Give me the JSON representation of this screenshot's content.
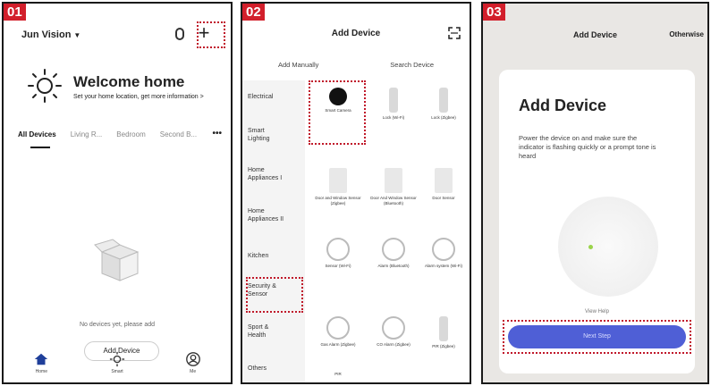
{
  "steps": [
    "01",
    "02",
    "03"
  ],
  "screen1": {
    "home_name": "Jun Vision",
    "welcome_title": "Welcome home",
    "welcome_sub": "Set your home location, get more information >",
    "tabs": [
      "All Devices",
      "Living R...",
      "Bedroom",
      "Second B..."
    ],
    "more": "•••",
    "empty_text": "No devices yet, please add",
    "add_device_button": "Add Device",
    "nav": [
      {
        "label": "Home",
        "icon": "home-icon"
      },
      {
        "label": "Smart",
        "icon": "sun-icon"
      },
      {
        "label": "Me",
        "icon": "profile-icon"
      }
    ]
  },
  "screen2": {
    "title": "Add Device",
    "subtabs": [
      "Add Manually",
      "Search Device"
    ],
    "categories": [
      "Electrical",
      "Smart Lighting",
      "Home Appliances I",
      "Home Appliances II",
      "Kitchen",
      "Security & Sensor",
      "Sport & Health",
      "Others"
    ],
    "devices": [
      {
        "label": "Smart Camera"
      },
      {
        "label": "Lock (Wi-Fi)"
      },
      {
        "label": "Lock (Zigbee)"
      },
      {
        "label": "Door and Window Sensor (Zigbee)"
      },
      {
        "label": "Door And Window Sensor (Bluetooth)"
      },
      {
        "label": "Door Sensor"
      },
      {
        "label": "Sensor (Wi-Fi)"
      },
      {
        "label": "Alarm (Bluetooth)"
      },
      {
        "label": "Alarm system (Wi-Fi)"
      },
      {
        "label": "Gas Alarm (Zigbee)"
      },
      {
        "label": "CO Alarm (Zigbee)"
      },
      {
        "label": "PIR (Zigbee)"
      }
    ],
    "others_item": "PIR"
  },
  "screen3": {
    "title": "Add Device",
    "other": "Otherwise",
    "card_title": "Add Device",
    "card_text": "Power the device on and make sure the indicator is flashing quickly or a prompt tone is heard",
    "view_help": "View Help",
    "next_button": "Next Step"
  },
  "colors": {
    "badge": "#d21f2b",
    "accent": "#4f5fd6",
    "indicator": "#9ad34a"
  }
}
